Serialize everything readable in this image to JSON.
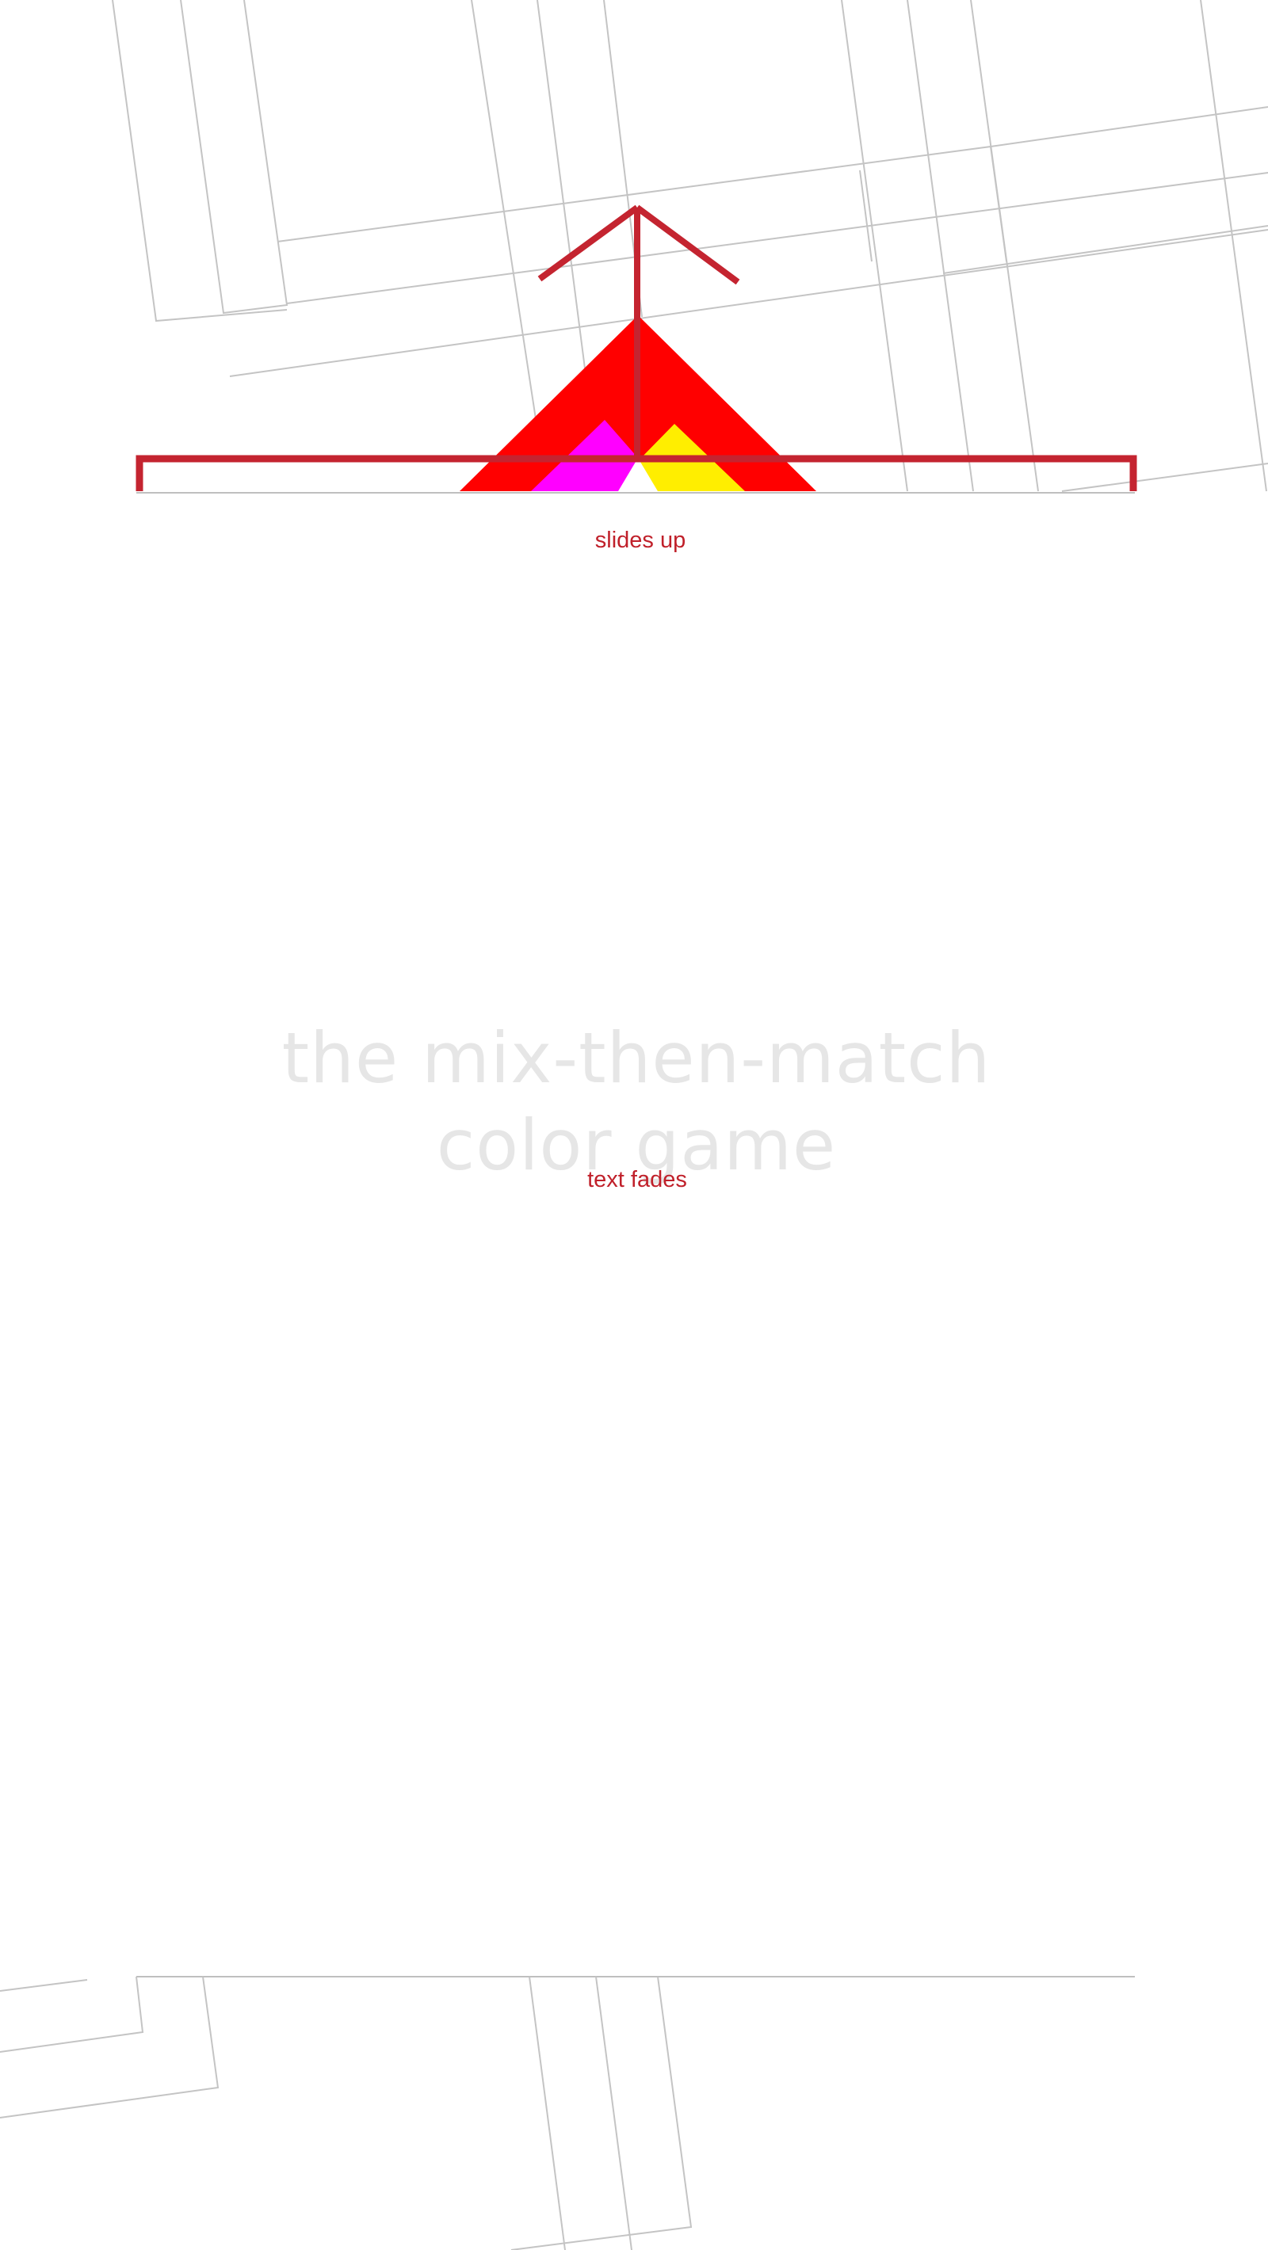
{
  "title": {
    "line1": "the mix-then-match",
    "line2": "color game"
  },
  "annotations": {
    "slides_up": "slides up",
    "text_fades": "text fades"
  },
  "colors": {
    "annotation": "#c0202a",
    "title_text": "#e6e6e6",
    "triangle_red": "#ff0000",
    "triangle_magenta": "#ff00ff",
    "triangle_yellow": "#ffee00",
    "grid_lines": "#bdbdbd"
  },
  "icons": {
    "slide_arrow": "up-arrow-icon",
    "logo": "triangle-logo-icon"
  }
}
